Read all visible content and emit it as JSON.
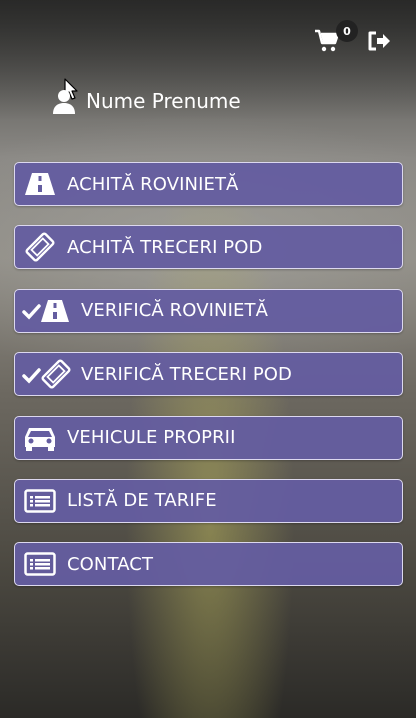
{
  "header": {
    "cart_count": "0",
    "icons": {
      "cart": "cart-icon",
      "logout": "logout-icon"
    }
  },
  "user": {
    "name": "Nume Prenume",
    "icon": "user-icon"
  },
  "menu": {
    "items": [
      {
        "label": "ACHITĂ ROVINIETĂ",
        "icon": "road-icon"
      },
      {
        "label": "ACHITĂ TRECERI POD",
        "icon": "ticket-icon"
      },
      {
        "label": "VERIFICĂ ROVINIETĂ",
        "icon": "check-road-icon"
      },
      {
        "label": "VERIFICĂ TRECERI POD",
        "icon": "check-ticket-icon"
      },
      {
        "label": "VEHICULE PROPRII",
        "icon": "car-icon"
      },
      {
        "label": "LISTĂ DE TARIFE",
        "icon": "list-icon"
      },
      {
        "label": "CONTACT",
        "icon": "list-icon"
      }
    ]
  },
  "colors": {
    "button_bg": "#645da0",
    "button_border": "#dcd8ef",
    "text": "#ffffff"
  }
}
